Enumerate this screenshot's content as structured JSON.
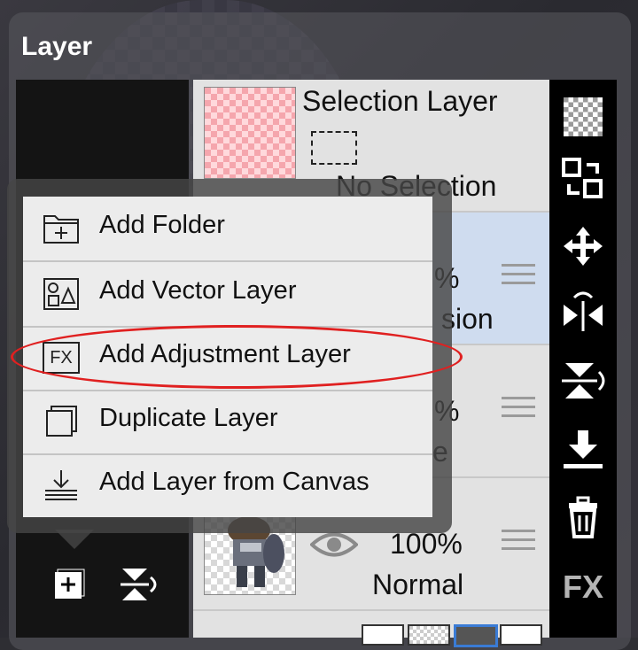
{
  "panel": {
    "title": "Layer"
  },
  "selection_layer": {
    "title": "Selection Layer",
    "status": "No Selection"
  },
  "layers": [
    {
      "opacity": "%",
      "blend": "sion"
    },
    {
      "opacity": "%",
      "blend": "e"
    },
    {
      "opacity": "100%",
      "blend": "Normal"
    }
  ],
  "menu": {
    "items": [
      {
        "label": "Add Folder",
        "icon": "add-folder-icon"
      },
      {
        "label": "Add Vector Layer",
        "icon": "vector-layer-icon"
      },
      {
        "label": "Add Adjustment Layer",
        "icon": "fx-icon",
        "icon_text": "FX"
      },
      {
        "label": "Duplicate Layer",
        "icon": "duplicate-icon"
      },
      {
        "label": "Add Layer from Canvas",
        "icon": "layer-from-canvas-icon"
      }
    ]
  },
  "toolbar": {
    "fx_label": "FX"
  },
  "colors": {
    "highlight": "#e02020",
    "selected_row": "#cfdcef",
    "toolbar_bg": "#000000"
  }
}
